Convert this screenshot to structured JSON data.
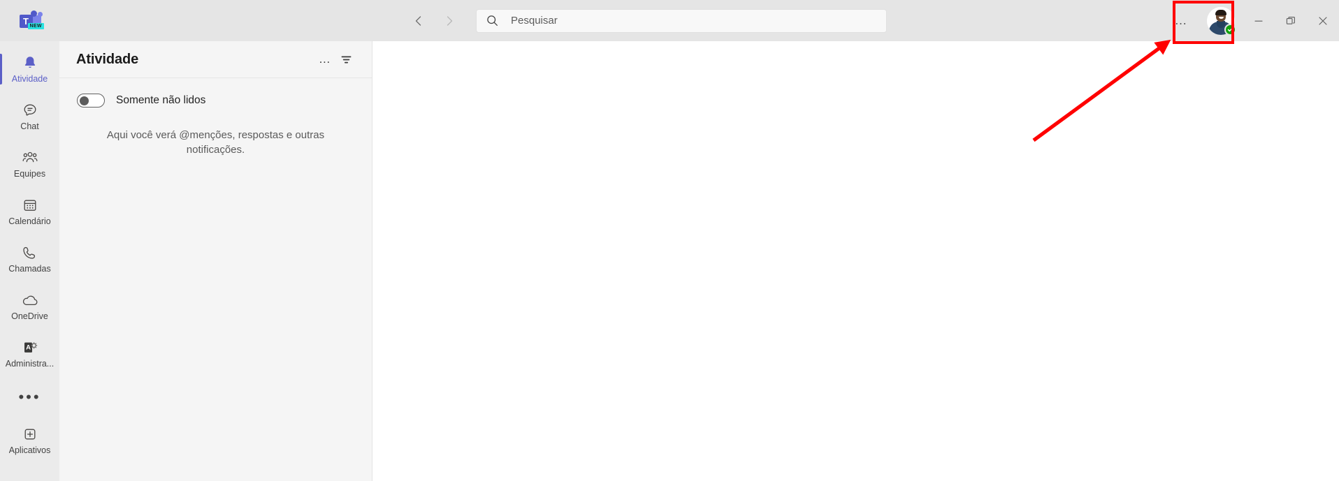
{
  "window": {
    "app_name": "Microsoft Teams",
    "logo": {
      "letter": "T",
      "badge_text": "NEW",
      "icon_name": "teams-logo"
    },
    "controls": {
      "minimize_label": "Minimizar",
      "maximize_label": "Restaurar",
      "close_label": "Fechar"
    }
  },
  "header": {
    "back_label": "Voltar",
    "forward_label": "Avançar",
    "search": {
      "placeholder": "Pesquisar",
      "value": "",
      "icon_name": "search-icon"
    },
    "more_options": "…",
    "account": {
      "name": "",
      "status": "Disponível",
      "status_color": "#13A10E",
      "icon_name": "user-avatar"
    }
  },
  "sidebar": {
    "items": [
      {
        "label": "Atividade",
        "icon_name": "bell-icon",
        "active": true
      },
      {
        "label": "Chat",
        "icon_name": "chat-bubble-icon",
        "active": false
      },
      {
        "label": "Equipes",
        "icon_name": "people-icon",
        "active": false
      },
      {
        "label": "Calendário",
        "icon_name": "calendar-icon",
        "active": false
      },
      {
        "label": "Chamadas",
        "icon_name": "phone-icon",
        "active": false
      },
      {
        "label": "OneDrive",
        "icon_name": "cloud-icon",
        "active": false
      },
      {
        "label": "Administra...",
        "icon_name": "admin-gear-icon",
        "active": false
      }
    ],
    "more": {
      "label": "…",
      "icon_name": "more-horizontal-icon"
    },
    "apps": {
      "label": "Aplicativos",
      "icon_name": "apps-plus-icon"
    }
  },
  "activity_panel": {
    "title": "Atividade",
    "more_options": "…",
    "filter_label": "Filtrar",
    "unread_toggle": {
      "label": "Somente não lidos",
      "enabled": false
    },
    "empty_state": "Aqui você verá @menções, respostas e outras notificações."
  },
  "annotation": {
    "box_color": "#FF0000",
    "arrow_color": "#FF0000",
    "target": "user-avatar"
  },
  "colors": {
    "accent": "#5B5FC7",
    "titlebar_bg": "#E5E5E5",
    "rail_bg": "#EBEBEB",
    "panel_bg": "#F5F5F5",
    "content_bg": "#FFFFFF",
    "status_available": "#13A10E",
    "annotation": "#FF0000"
  }
}
